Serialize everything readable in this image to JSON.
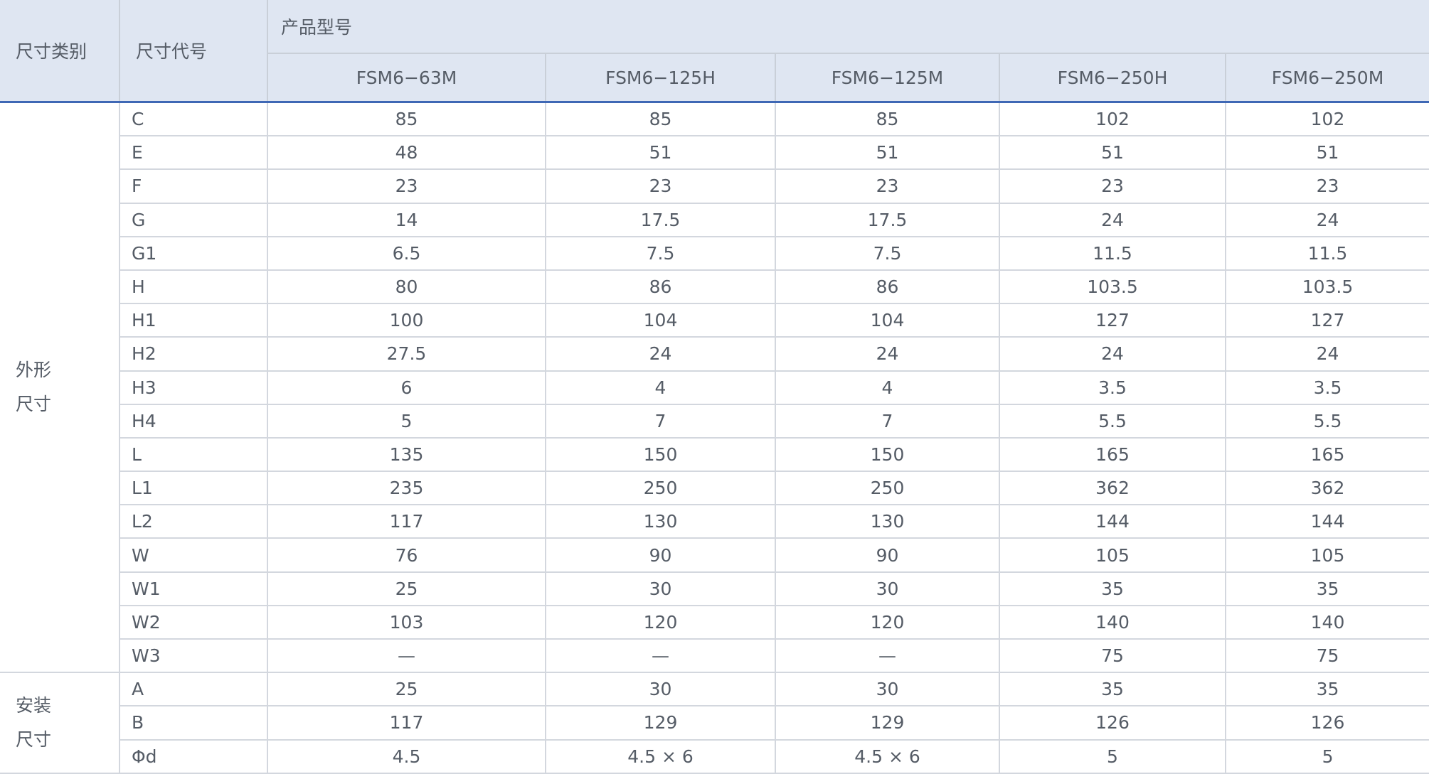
{
  "header": {
    "category": "尺寸类别",
    "code": "尺寸代号",
    "group": "产品型号",
    "models": [
      "FSM6−63M",
      "FSM6−125H",
      "FSM6−125M",
      "FSM6−250H",
      "FSM6−250M"
    ]
  },
  "groups": [
    {
      "label_lines": [
        "外形",
        "尺寸"
      ],
      "rows": [
        {
          "code": "C",
          "values": [
            "85",
            "85",
            "85",
            "102",
            "102"
          ]
        },
        {
          "code": "E",
          "values": [
            "48",
            "51",
            "51",
            "51",
            "51"
          ]
        },
        {
          "code": "F",
          "values": [
            "23",
            "23",
            "23",
            "23",
            "23"
          ]
        },
        {
          "code": "G",
          "values": [
            "14",
            "17.5",
            "17.5",
            "24",
            "24"
          ]
        },
        {
          "code": "G1",
          "values": [
            "6.5",
            "7.5",
            "7.5",
            "11.5",
            "11.5"
          ]
        },
        {
          "code": "H",
          "values": [
            "80",
            "86",
            "86",
            "103.5",
            "103.5"
          ]
        },
        {
          "code": "H1",
          "values": [
            "100",
            "104",
            "104",
            "127",
            "127"
          ]
        },
        {
          "code": "H2",
          "values": [
            "27.5",
            "24",
            "24",
            "24",
            "24"
          ]
        },
        {
          "code": "H3",
          "values": [
            "6",
            "4",
            "4",
            "3.5",
            "3.5"
          ]
        },
        {
          "code": "H4",
          "values": [
            "5",
            "7",
            "7",
            "5.5",
            "5.5"
          ]
        },
        {
          "code": "L",
          "values": [
            "135",
            "150",
            "150",
            "165",
            "165"
          ]
        },
        {
          "code": "L1",
          "values": [
            "235",
            "250",
            "250",
            "362",
            "362"
          ]
        },
        {
          "code": "L2",
          "values": [
            "117",
            "130",
            "130",
            "144",
            "144"
          ]
        },
        {
          "code": "W",
          "values": [
            "76",
            "90",
            "90",
            "105",
            "105"
          ]
        },
        {
          "code": "W1",
          "values": [
            "25",
            "30",
            "30",
            "35",
            "35"
          ]
        },
        {
          "code": "W2",
          "values": [
            "103",
            "120",
            "120",
            "140",
            "140"
          ]
        },
        {
          "code": "W3",
          "values": [
            "—",
            "—",
            "—",
            "75",
            "75"
          ]
        }
      ]
    },
    {
      "label_lines": [
        "安装",
        "尺寸"
      ],
      "rows": [
        {
          "code": "A",
          "values": [
            "25",
            "30",
            "30",
            "35",
            "35"
          ]
        },
        {
          "code": "B",
          "values": [
            "117",
            "129",
            "129",
            "126",
            "126"
          ]
        },
        {
          "code": "Φd",
          "values": [
            "4.5",
            "4.5 × 6",
            "4.5 × 6",
            "5",
            "5"
          ]
        }
      ]
    }
  ],
  "colors": {
    "header_bg": "#dfe6f2",
    "accent_rule": "#3f68b5",
    "grid": "#d3d7de",
    "text": "#555c66"
  }
}
